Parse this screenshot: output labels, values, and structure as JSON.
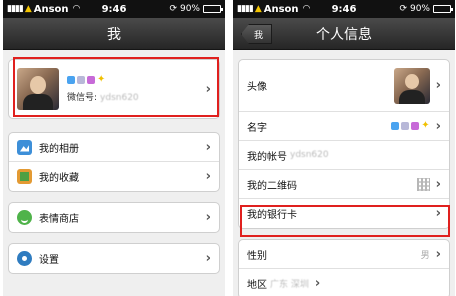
{
  "status": {
    "carrier": "Anson",
    "time": "9:46",
    "battery": "90%",
    "battery_level": 0.9
  },
  "me_screen": {
    "title": "我",
    "profile": {
      "wechat_id_label": "微信号:",
      "wechat_id": "ydsn620"
    },
    "menu": [
      {
        "label": "我的相册",
        "icon": "album-icon"
      },
      {
        "label": "我的收藏",
        "icon": "favorites-icon"
      },
      {
        "label": "表情商店",
        "icon": "emoji-icon"
      },
      {
        "label": "设置",
        "icon": "settings-icon"
      }
    ]
  },
  "info_screen": {
    "title": "个人信息",
    "back_label": "我",
    "rows": {
      "avatar": "头像",
      "name": "名字",
      "account": "我的帐号",
      "account_value": "ydsn620",
      "qr": "我的二维码",
      "bank": "我的银行卡",
      "gender": "性别",
      "gender_value": "男",
      "region": "地区",
      "region_value": "广东 深圳"
    }
  },
  "colors": {
    "highlight": "#e0201e",
    "navbar": "#333333",
    "background": "#efefef"
  }
}
